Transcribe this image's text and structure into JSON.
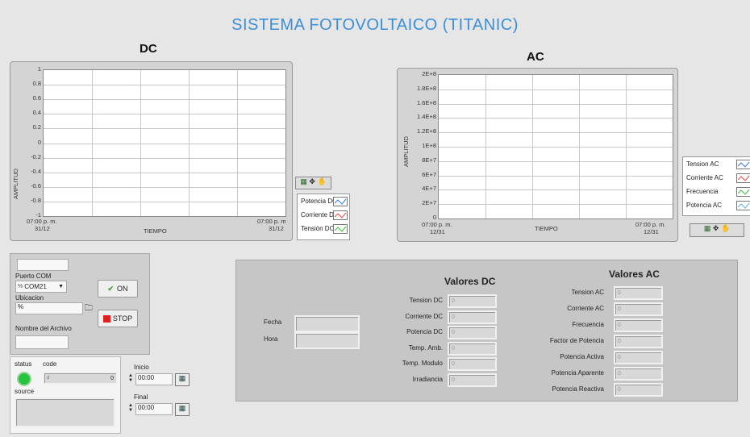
{
  "title": "SISTEMA FOTOVOLTAICO (TITANIC)",
  "dc_graph": {
    "title": "DC",
    "ylabel": "AMPLITUD",
    "xlabel": "TIEMPO",
    "yticks": [
      "1",
      "0.8",
      "0.6",
      "0.4",
      "0.2",
      "0",
      "-0.2",
      "-0.4",
      "-0.6",
      "-0.8",
      "-1"
    ],
    "x_start_time": "07:00 p. m.",
    "x_start_date": "31/12",
    "x_end_time": "07:00 p. m",
    "x_end_date": "31/12",
    "legend": [
      {
        "label": "Potencia DC",
        "color": "#3a7bd5"
      },
      {
        "label": "Corriente DC",
        "color": "#e05050"
      },
      {
        "label": "Tensión DC",
        "color": "#3cbf3c"
      }
    ]
  },
  "ac_graph": {
    "title": "AC",
    "ylabel": "AMPLITUD",
    "xlabel": "TIEMPO",
    "yticks": [
      "2E+8",
      "1.8E+8",
      "1.6E+8",
      "1.4E+8",
      "1.2E+8",
      "1E+8",
      "8E+7",
      "6E+7",
      "4E+7",
      "2E+7",
      "0"
    ],
    "x_start_time": "07:00 p. m.",
    "x_start_date": "12/31",
    "x_end_time": "07:00 p. m.",
    "x_end_date": "12/31",
    "legend": [
      {
        "label": "Tension AC",
        "color": "#3a7bd5"
      },
      {
        "label": "Corriente AC",
        "color": "#e05050"
      },
      {
        "label": "Frecuencia",
        "color": "#3cbf3c"
      },
      {
        "label": "Potencia AC",
        "color": "#5fb0e0"
      }
    ]
  },
  "controls": {
    "com_label": "Puerto COM",
    "com_prefix": "%",
    "com_value": "COM21",
    "ubicacion_label": "Ubicacion",
    "ubicacion_value": "%",
    "filename_label": "Nombre del Archivo",
    "on_label": "ON",
    "stop_label": "STOP"
  },
  "error_cluster": {
    "status_label": "status",
    "code_label": "code",
    "code_prefix": "d",
    "code_value": "0",
    "source_label": "source"
  },
  "timing": {
    "inicio_label": "Inicio",
    "inicio_value": "00:00",
    "final_label": "Final",
    "final_value": "00:00"
  },
  "values_panel": {
    "fecha_label": "Fecha",
    "hora_label": "Hora",
    "dc_title": "Valores DC",
    "dc_items": [
      {
        "label": "Tension DC",
        "value": "0"
      },
      {
        "label": "Corriente DC",
        "value": "0"
      },
      {
        "label": "Potencia DC",
        "value": "0"
      },
      {
        "label": "Temp. Amb.",
        "value": "0"
      },
      {
        "label": "Temp. Modulo",
        "value": "0"
      },
      {
        "label": "Irradiancia",
        "value": "0"
      }
    ],
    "ac_title": "Valores AC",
    "ac_items": [
      {
        "label": "Tension AC",
        "value": "0"
      },
      {
        "label": "Corriente AC",
        "value": "0"
      },
      {
        "label": "Frecuencia",
        "value": "0"
      },
      {
        "label": "Factor de Potencia",
        "value": "0"
      },
      {
        "label": "Potencia Activa",
        "value": "0"
      },
      {
        "label": "Potencia Aparente",
        "value": "0"
      },
      {
        "label": "Potencia Reactiva",
        "value": "0"
      }
    ]
  }
}
